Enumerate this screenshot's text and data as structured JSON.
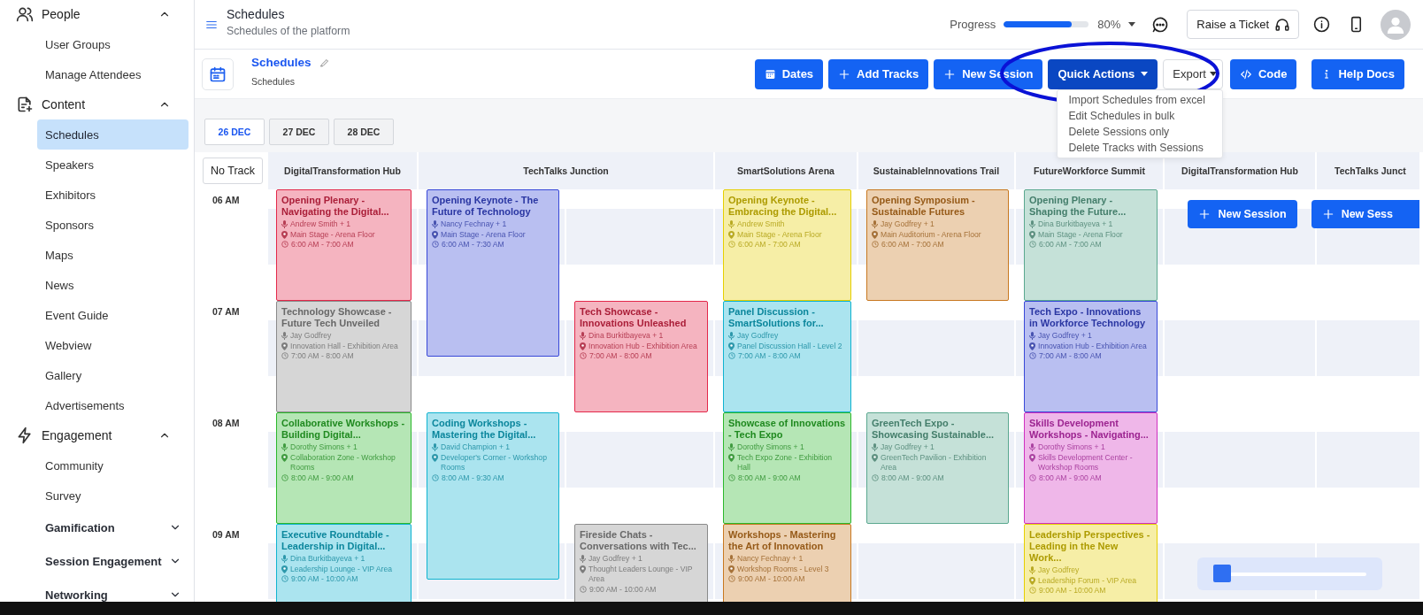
{
  "sidebar": {
    "sections": [
      {
        "label": "People",
        "expanded": true,
        "children": [
          {
            "label": "User Groups",
            "selected": false
          },
          {
            "label": "Manage Attendees",
            "selected": false
          }
        ]
      },
      {
        "label": "Content",
        "expanded": true,
        "children": [
          {
            "label": "Schedules",
            "selected": true
          },
          {
            "label": "Speakers",
            "selected": false
          },
          {
            "label": "Exhibitors",
            "selected": false
          },
          {
            "label": "Sponsors",
            "selected": false
          },
          {
            "label": "Maps",
            "selected": false
          },
          {
            "label": "News",
            "selected": false
          },
          {
            "label": "Event Guide",
            "selected": false
          },
          {
            "label": "Webview",
            "selected": false
          },
          {
            "label": "Gallery",
            "selected": false
          },
          {
            "label": "Advertisements",
            "selected": false
          }
        ]
      },
      {
        "label": "Engagement",
        "expanded": true,
        "children": [
          {
            "label": "Community",
            "selected": false
          },
          {
            "label": "Survey",
            "selected": false
          },
          {
            "label": "Gamification",
            "selected": false,
            "expanded": false
          },
          {
            "label": "Session Engagement",
            "selected": false,
            "expanded": false
          },
          {
            "label": "Networking",
            "selected": false,
            "expanded": false
          }
        ]
      }
    ]
  },
  "header": {
    "title": "Schedules",
    "subtitle": "Schedules of the platform",
    "progress": {
      "label": "Progress",
      "level": 0.8,
      "reading": "80%"
    },
    "ticket_button": "Raise a Ticket"
  },
  "toolbar": {
    "title": "Schedules",
    "subtitle": "Schedules",
    "buttons": [
      {
        "label": "Dates",
        "kind": "primary"
      },
      {
        "label": "Add Tracks",
        "kind": "primary"
      },
      {
        "label": "New Session",
        "kind": "primary"
      },
      {
        "label": "Quick Actions",
        "kind": "menu",
        "expanded": true,
        "highlighted": true,
        "menu": [
          "Import Schedules from excel",
          "Edit Schedules in bulk",
          "Delete Sessions only",
          "Delete Tracks with Sessions"
        ]
      },
      {
        "label": "Export",
        "kind": "outline-menu",
        "expanded": false,
        "highlighted": false
      },
      {
        "label": "Code",
        "kind": "primary"
      },
      {
        "label": "Help Docs",
        "kind": "primary"
      }
    ]
  },
  "date_tabs": [
    {
      "label": "26 DEC",
      "selected": true
    },
    {
      "label": "27 DEC",
      "selected": false
    },
    {
      "label": "28 DEC",
      "selected": false
    }
  ],
  "schedule": {
    "no_track_button": "No Track",
    "time_labels": [
      "06 AM",
      "07 AM",
      "08 AM",
      "09 AM"
    ],
    "tracks": [
      {
        "name": "DigitalTransformation Hub",
        "lanes": [
          [
            {
              "title": "Opening Plenary - Navigating the Digital...",
              "speaker": "Andrew Smith + 1",
              "location": "Main Stage - Arena Floor",
              "time": "6:00 AM - 7:00 AM",
              "color": "#e3284a"
            },
            {
              "title": "Technology Showcase - Future Tech Unveiled",
              "speaker": "Jay Godfrey",
              "location": "Innovation Hall - Exhibition Area",
              "time": "7:00 AM - 8:00 AM",
              "color": "#8a8a8a"
            },
            {
              "title": "Collaborative Workshops - Building Digital...",
              "speaker": "Dorothy Simons + 1",
              "location": "Collaboration Zone - Workshop Rooms",
              "time": "8:00 AM - 9:00 AM",
              "color": "#2bb82b"
            },
            {
              "title": "Executive Roundtable - Leadership in Digital...",
              "speaker": "Dina Burkitbayeva + 1",
              "location": "Leadership Lounge - VIP Area",
              "time": "9:00 AM - 10:00 AM",
              "color": "#0fb3d0"
            }
          ]
        ]
      },
      {
        "name": "TechTalks Junction",
        "lanes": [
          [
            {
              "title": "Opening Keynote - The Future of Technology",
              "speaker": "Nancy Fechnay + 1",
              "location": "Main Stage - Arena Floor",
              "time": "6:00 AM - 7:30 AM",
              "color": "#3848d8"
            },
            {
              "title": "Coding Workshops - Mastering the Digital...",
              "speaker": "David Champion + 1",
              "location": "Developer's Corner - Workshop Rooms",
              "time": "8:00 AM - 9:30 AM",
              "color": "#0fb3d0"
            }
          ],
          [
            {
              "title": "Tech Showcase - Innovations Unleashed",
              "speaker": "Dina Burkitbayeva + 1",
              "location": "Innovation Hub - Exhibition Area",
              "time": "7:00 AM - 8:00 AM",
              "color": "#e3284a"
            },
            {
              "title": "Fireside Chats - Conversations with Tec...",
              "speaker": "Jay Godfrey + 1",
              "location": "Thought Leaders Lounge - VIP Area",
              "time": "9:00 AM - 10:00 AM",
              "color": "#8a8a8a"
            }
          ]
        ]
      },
      {
        "name": "SmartSolutions Arena",
        "lanes": [
          [
            {
              "title": "Opening Keynote - Embracing the Digital...",
              "speaker": "Andrew Smith",
              "location": "Main Stage - Arena Floor",
              "time": "6:00 AM - 7:00 AM",
              "color": "#e6cf00"
            },
            {
              "title": "Panel Discussion - SmartSolutions for...",
              "speaker": "Jay Godfrey",
              "location": "Panel Discussion Hall - Level 2",
              "time": "7:00 AM - 8:00 AM",
              "color": "#0fb3d0"
            },
            {
              "title": "Showcase of Innovations - Tech Expo",
              "speaker": "Dorothy Simons + 1",
              "location": "Tech Expo Zone - Exhibition Hall",
              "time": "8:00 AM - 9:00 AM",
              "color": "#2bb82b"
            },
            {
              "title": "Workshops - Mastering the Art of Innovation",
              "speaker": "Nancy Fechnay + 1",
              "location": "Workshop Rooms - Level 3",
              "time": "9:00 AM - 10:00 AM",
              "color": "#c87820"
            }
          ]
        ]
      },
      {
        "name": "SustainableInnovations Trail",
        "lanes": [
          [
            {
              "title": "Opening Symposium - Sustainable Futures",
              "speaker": "Jay Godfrey + 1",
              "location": "Main Auditorium - Arena Floor",
              "time": "6:00 AM - 7:00 AM",
              "color": "#c87820"
            },
            {
              "title": "GreenTech Expo - Showcasing Sustainable...",
              "speaker": "Jay Godfrey + 1",
              "location": "GreenTech Pavilion - Exhibition Area",
              "time": "8:00 AM - 9:00 AM",
              "color": "#5aa88f"
            }
          ]
        ]
      },
      {
        "name": "FutureWorkforce Summit",
        "lanes": [
          [
            {
              "title": "Opening Plenary - Shaping the Future...",
              "speaker": "Dina Burkitbayeva + 1",
              "location": "Main Stage - Arena Floor",
              "time": "6:00 AM - 7:00 AM",
              "color": "#5aa88f"
            },
            {
              "title": "Tech Expo - Innovations in Workforce Technology",
              "speaker": "Jay Godfrey + 1",
              "location": "Innovation Hub - Exhibition Area",
              "time": "7:00 AM - 8:00 AM",
              "color": "#3848d8"
            },
            {
              "title": "Skills Development Workshops - Navigating...",
              "speaker": "Dorothy Simons + 1",
              "location": "Skills Development Center - Workshop Rooms",
              "time": "8:00 AM - 9:00 AM",
              "color": "#d030c0"
            },
            {
              "title": "Leadership Perspectives - Leading in the New Work...",
              "speaker": "Jay Godfrey",
              "location": "Leadership Forum - VIP Area",
              "time": "9:00 AM - 10:00 AM",
              "color": "#e6cf00"
            }
          ]
        ]
      },
      {
        "name": "DigitalTransformation Hub",
        "action": "New Session"
      },
      {
        "name": "TechTalks Junct",
        "action": "New Sess"
      }
    ]
  }
}
